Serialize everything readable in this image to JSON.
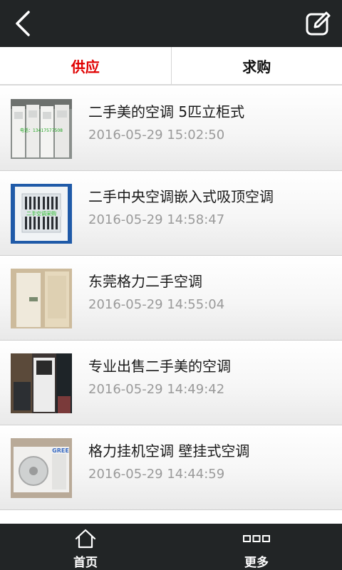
{
  "header": {
    "back_icon": "chevron-left-icon",
    "edit_icon": "edit-icon"
  },
  "tabs": [
    {
      "label": "供应",
      "active": true
    },
    {
      "label": "求购",
      "active": false
    }
  ],
  "items": [
    {
      "title": "二手美的空调 5匹立柜式",
      "date": "2016-05-29 15:02:50",
      "image_text": "电话：13417577508"
    },
    {
      "title": "二手中央空调嵌入式吸顶空调",
      "date": "2016-05-29 14:58:47",
      "image_text": "二手空调采购"
    },
    {
      "title": "东莞格力二手空调",
      "date": "2016-05-29 14:55:04",
      "image_text": ""
    },
    {
      "title": "专业出售二手美的空调",
      "date": "2016-05-29 14:49:42",
      "image_text": ""
    },
    {
      "title": "格力挂机空调 壁挂式空调",
      "date": "2016-05-29 14:44:59",
      "image_text": "GREE"
    }
  ],
  "bottom_nav": [
    {
      "label": "首页",
      "icon": "home-icon"
    },
    {
      "label": "更多",
      "icon": "more-icon"
    }
  ],
  "colors": {
    "bar": "#222526",
    "active_tab": "#e00000",
    "date": "#9a9a9a"
  }
}
